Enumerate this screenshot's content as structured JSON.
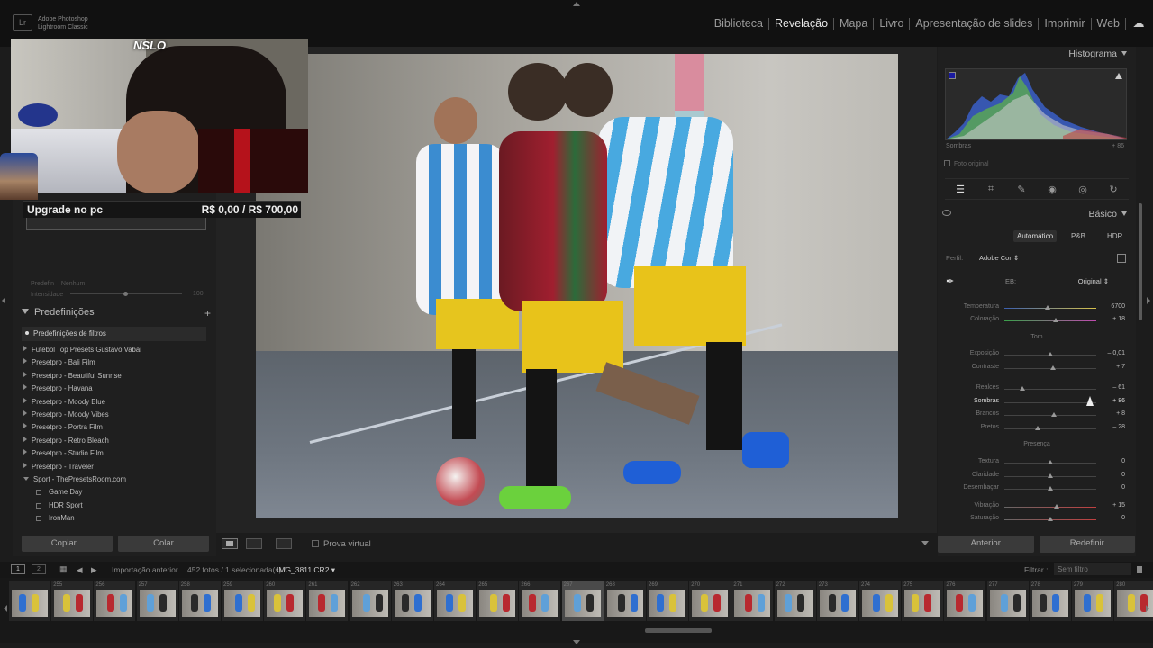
{
  "app": {
    "name_line1": "Adobe Photoshop",
    "name_line2": "Lightroom Classic",
    "logo": "Lr"
  },
  "modules": [
    "Biblioteca",
    "Revelação",
    "Mapa",
    "Livro",
    "Apresentação de slides",
    "Imprimir",
    "Web"
  ],
  "active_module": "Revelação",
  "stream_overlay": {
    "logo_text": "NSLO",
    "donation_label": "Upgrade no pc",
    "donation_value": "R$ 0,00 / R$ 700,00"
  },
  "left_panel": {
    "preset_label": "Predefin",
    "preset_value": "Nenhum",
    "intensity_label": "Intensidade",
    "intensity_value": "100",
    "intensity_level": 0.58,
    "presets_title": "Predefinições",
    "presets_add": "+",
    "filter_label": "Predefinições de filtros",
    "preset_items": [
      {
        "label": "Futebol Top Presets Gustavo Vabai",
        "type": "folder"
      },
      {
        "label": "Presetpro - Bali Film",
        "type": "folder"
      },
      {
        "label": "Presetpro - Beautiful Sunrise",
        "type": "folder"
      },
      {
        "label": "Presetpro - Havana",
        "type": "folder"
      },
      {
        "label": "Presetpro - Moody Blue",
        "type": "folder"
      },
      {
        "label": "Presetpro - Moody Vibes",
        "type": "folder"
      },
      {
        "label": "Presetpro - Portra Film",
        "type": "folder"
      },
      {
        "label": "Presetpro - Retro Bleach",
        "type": "folder"
      },
      {
        "label": "Presetpro - Studio Film",
        "type": "folder"
      },
      {
        "label": "Presetpro - Traveler",
        "type": "folder"
      },
      {
        "label": "Sport - ThePresetsRoom.com",
        "type": "open"
      },
      {
        "label": "Game Day",
        "type": "sub"
      },
      {
        "label": "HDR Sport",
        "type": "sub"
      },
      {
        "label": "IronMan",
        "type": "sub"
      }
    ],
    "copy_button": "Copiar...",
    "paste_button": "Colar"
  },
  "viewbar": {
    "virtual_proof_label": "Prova virtual"
  },
  "right_panel": {
    "histogram_title": "Histograma",
    "histogram_readout_label": "Sombras",
    "histogram_readout_value": "+ 86",
    "original_photo_label": "Foto original",
    "basic_title": "Básico",
    "treatments": [
      "Automático",
      "P&B",
      "HDR"
    ],
    "profile_label": "Perfil:",
    "profile_value": "Adobe Cor ⇕",
    "wb_label": "EB:",
    "wb_value": "Original ⇕",
    "tone_label": "Tom",
    "presence_label": "Presença",
    "sliders": [
      {
        "label": "Temperatura",
        "value": "6700",
        "level": 0.47,
        "group": "wb"
      },
      {
        "label": "Coloração",
        "value": "+ 18",
        "level": 0.56,
        "group": "wb"
      },
      {
        "label": "Exposição",
        "value": "– 0,01",
        "level": 0.5,
        "group": "tone"
      },
      {
        "label": "Contraste",
        "value": "+ 7",
        "level": 0.53,
        "group": "tone"
      },
      {
        "label": "Realces",
        "value": "– 61",
        "level": 0.2,
        "group": "tone2"
      },
      {
        "label": "Sombras",
        "value": "+ 86",
        "level": 0.93,
        "group": "tone2",
        "active": true
      },
      {
        "label": "Brancos",
        "value": "+ 8",
        "level": 0.54,
        "group": "tone2"
      },
      {
        "label": "Pretos",
        "value": "– 28",
        "level": 0.36,
        "group": "tone2"
      },
      {
        "label": "Textura",
        "value": "0",
        "level": 0.5,
        "group": "presence"
      },
      {
        "label": "Claridade",
        "value": "0",
        "level": 0.5,
        "group": "presence"
      },
      {
        "label": "Desembaçar",
        "value": "0",
        "level": 0.5,
        "group": "presence"
      },
      {
        "label": "Vibração",
        "value": "+ 15",
        "level": 0.57,
        "group": "presence2"
      },
      {
        "label": "Saturação",
        "value": "0",
        "level": 0.5,
        "group": "presence2"
      }
    ],
    "previous_button": "Anterior",
    "reset_button": "Redefinir"
  },
  "filmbar": {
    "view1": "1",
    "view2": "2",
    "source": "Importação anterior",
    "count": "452 fotos / 1 selecionada(s) /",
    "filename": "IMG_3811.CR2 ▾",
    "filter_label": "Filtrar :",
    "filter_value": "Sem filtro"
  },
  "filmstrip": {
    "numbers": [
      "",
      "255",
      "256",
      "257",
      "258",
      "259",
      "260",
      "261",
      "262",
      "263",
      "264",
      "265",
      "266",
      "267",
      "268",
      "269",
      "270",
      "271",
      "272",
      "273",
      "274",
      "275",
      "276",
      "277",
      "278",
      "279",
      "280"
    ],
    "selected_index": 13
  },
  "colors": {
    "accent": "#e8e8e8",
    "panel": "#1f1f1f",
    "background": "#1c1c1c"
  },
  "icons": [
    "cloud-icon",
    "edit-sliders-icon",
    "crop-icon",
    "heal-icon",
    "red-eye-icon",
    "mask-icon",
    "eyedropper-icon",
    "eye-icon",
    "grid-icon"
  ]
}
